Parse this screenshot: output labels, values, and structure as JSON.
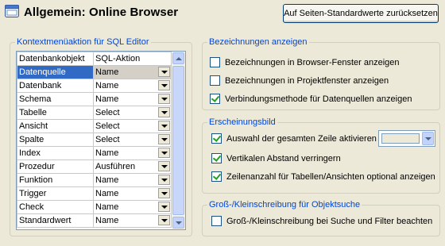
{
  "header": {
    "title": "Allgemein: Online Browser",
    "reset_button": "Auf Seiten-Standardwerte zurücksetzen"
  },
  "context_menu": {
    "legend": "Kontextmenüaktion für SQL Editor",
    "columns": [
      "Datenbankobjekt",
      "SQL-Aktion"
    ],
    "rows": [
      {
        "object": "Datenquelle",
        "action": "Name"
      },
      {
        "object": "Datenbank",
        "action": "Name"
      },
      {
        "object": "Schema",
        "action": "Name"
      },
      {
        "object": "Tabelle",
        "action": "Select"
      },
      {
        "object": "Ansicht",
        "action": "Select"
      },
      {
        "object": "Spalte",
        "action": "Select"
      },
      {
        "object": "Index",
        "action": "Name"
      },
      {
        "object": "Prozedur",
        "action": "Ausführen"
      },
      {
        "object": "Funktion",
        "action": "Name"
      },
      {
        "object": "Trigger",
        "action": "Name"
      },
      {
        "object": "Check",
        "action": "Name"
      },
      {
        "object": "Standardwert",
        "action": "Name"
      }
    ],
    "selected_index": 0
  },
  "labels_group": {
    "legend": "Bezeichnungen anzeigen",
    "options": [
      {
        "label": "Bezeichnungen in Browser-Fenster anzeigen",
        "checked": false
      },
      {
        "label": "Bezeichnungen in Projektfenster anzeigen",
        "checked": false
      },
      {
        "label": "Verbindungsmethode für Datenquellen anzeigen",
        "checked": true
      }
    ]
  },
  "appearance_group": {
    "legend": "Erscheinungsbild",
    "options": [
      {
        "label": "Auswahl der gesamten Zeile aktivieren",
        "checked": true
      },
      {
        "label": "Vertikalen Abstand verringern",
        "checked": true
      },
      {
        "label": "Zeilenanzahl für Tabellen/Ansichten optional anzeigen",
        "checked": true
      }
    ],
    "selection_color": "#ece9d8"
  },
  "case_group": {
    "legend": "Groß-/Kleinschreibung für Objektsuche",
    "options": [
      {
        "label": "Groß-/Kleinschreibung bei Suche und Filter beachten",
        "checked": false
      }
    ]
  },
  "colors": {
    "accent": "#0046d5",
    "selection": "#316ac5",
    "checkmark": "#21a121"
  },
  "icons": [
    "browser-window-icon",
    "dropdown-arrow-icon",
    "scroll-up-icon",
    "scroll-down-icon",
    "check-icon"
  ]
}
